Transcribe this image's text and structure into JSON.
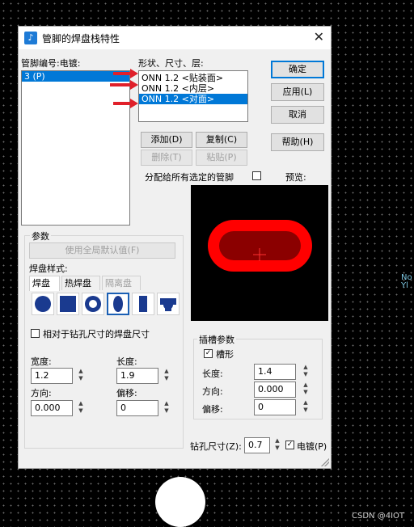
{
  "window": {
    "title": "管脚的焊盘栈特性",
    "close_symbol": "✕",
    "app_icon_symbol": "♪"
  },
  "pin_list": {
    "label": "管脚编号:电镀:",
    "items": [
      "3 (P)"
    ],
    "selected_index": 0
  },
  "layer_list": {
    "label": "形状、尺寸、层:",
    "items": [
      "ONN 1.2 <贴装面>",
      "ONN 1.2 <内层>",
      "ONN 1.2 <对面>"
    ],
    "selected_index": 2
  },
  "buttons": {
    "ok": "确定",
    "apply": "应用(L)",
    "cancel": "取消",
    "help": "帮助(H)",
    "add": "添加(D)",
    "copy": "复制(C)",
    "delete": "删除(T)",
    "paste": "粘贴(P)"
  },
  "assign_all": {
    "label": "分配给所有选定的管脚",
    "checked": false
  },
  "preview": {
    "label": "预览:",
    "pad_color": "#ff0000",
    "hole_color": "#8b0000",
    "cross_color": "#ff3030"
  },
  "params": {
    "label": "参数",
    "use_global_default": "使用全局默认值(F)",
    "pad_style_label": "焊盘样式:",
    "tabs": [
      "焊盘",
      "热焊盘",
      "隔离盘"
    ],
    "active_tab": 0,
    "shapes": [
      "round-pad-icon",
      "square-pad-icon",
      "annular-pad-icon",
      "oval-pad-icon",
      "rectangle-pad-icon",
      "custom-pad-icon"
    ],
    "selected_shape": 3,
    "relative_drill": {
      "label": "相对于钻孔尺寸的焊盘尺寸",
      "checked": false
    },
    "width_label": "宽度:",
    "width_value": "1.2",
    "length_label": "长度:",
    "length_value": "1.9",
    "direction_label": "方向:",
    "direction_value": "0.000",
    "offset_label": "偏移:",
    "offset_value": "0"
  },
  "slot": {
    "label": "插槽参数",
    "slotted": {
      "label": "槽形",
      "checked": true
    },
    "length_label": "长度:",
    "length_value": "1.4",
    "direction_label": "方向:",
    "direction_value": "0.000",
    "offset_label": "偏移:",
    "offset_value": "0"
  },
  "drill": {
    "label": "钻孔尺寸(Z):",
    "value": "0.7",
    "plated": {
      "label": "电镀(P)",
      "checked": true
    }
  },
  "spin_symbols": {
    "up": "▲",
    "down": "▼"
  },
  "background": {
    "pin_label_top": "No",
    "pin_label_bottom": "Yl",
    "watermark": "CSDN @4IOT"
  },
  "colors": {
    "selection": "#0078d7",
    "annotation_arrow": "#e0202a",
    "canvas": "#000000"
  }
}
